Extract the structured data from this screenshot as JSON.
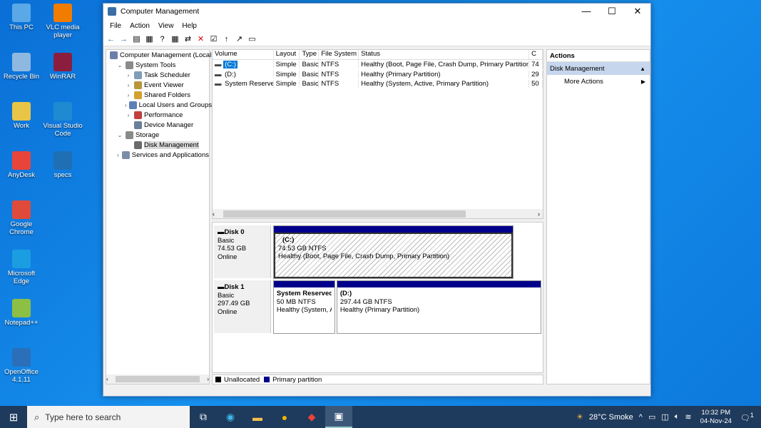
{
  "desktop": {
    "icons": [
      {
        "label": "This PC",
        "color": "#5aa9e6"
      },
      {
        "label": "VLC media player",
        "color": "#f07c00"
      },
      {
        "label": "Recycle Bin",
        "color": "#8fb8e0"
      },
      {
        "label": "WinRAR",
        "color": "#8b1e3f"
      },
      {
        "label": "Work",
        "color": "#e8c547"
      },
      {
        "label": "Visual Studio Code",
        "color": "#1f8ad2"
      },
      {
        "label": "AnyDesk",
        "color": "#e8443a"
      },
      {
        "label": "specs",
        "color": "#1f6fb5"
      },
      {
        "label": "Google Chrome",
        "color": "#e04a3a"
      },
      {
        "label": "Microsoft Edge",
        "color": "#1b9de2"
      },
      {
        "label": "Notepad++",
        "color": "#8dbf45"
      },
      {
        "label": "OpenOffice 4.1.11",
        "color": "#2a6fb8"
      }
    ]
  },
  "window": {
    "title": "Computer Management",
    "controls": {
      "minimize": "—",
      "maximize": "☐",
      "close": "✕"
    },
    "menu": [
      "File",
      "Action",
      "View",
      "Help"
    ],
    "toolbar": [
      "←",
      "→",
      "▤",
      "▦",
      "?",
      "▦",
      "⇄",
      "✕",
      "☑",
      "↑",
      "↗",
      "▭"
    ],
    "tree": [
      {
        "label": "Computer Management (Local",
        "exp": "",
        "indent": 0,
        "color": "#6b7fa8"
      },
      {
        "label": "System Tools",
        "exp": "⌄",
        "indent": 1,
        "color": "#8a8a8a"
      },
      {
        "label": "Task Scheduler",
        "exp": "›",
        "indent": 2,
        "color": "#7f9db9"
      },
      {
        "label": "Event Viewer",
        "exp": "›",
        "indent": 2,
        "color": "#b8963c"
      },
      {
        "label": "Shared Folders",
        "exp": "›",
        "indent": 2,
        "color": "#d4a030"
      },
      {
        "label": "Local Users and Groups",
        "exp": "›",
        "indent": 2,
        "color": "#5f7fb5"
      },
      {
        "label": "Performance",
        "exp": "›",
        "indent": 2,
        "color": "#c04040"
      },
      {
        "label": "Device Manager",
        "exp": "",
        "indent": 2,
        "color": "#6a7f9a"
      },
      {
        "label": "Storage",
        "exp": "⌄",
        "indent": 1,
        "color": "#8a8a8a"
      },
      {
        "label": "Disk Management",
        "exp": "",
        "indent": 2,
        "color": "#6b6b6b",
        "selected": true
      },
      {
        "label": "Services and Applications",
        "exp": "›",
        "indent": 1,
        "color": "#7a8ea8"
      }
    ],
    "volumes": {
      "headers": [
        "Volume",
        "Layout",
        "Type",
        "File System",
        "Status",
        "C"
      ],
      "rows": [
        [
          "(C:)",
          "Simple",
          "Basic",
          "NTFS",
          "Healthy (Boot, Page File, Crash Dump, Primary Partition)",
          "74"
        ],
        [
          "(D:)",
          "Simple",
          "Basic",
          "NTFS",
          "Healthy (Primary Partition)",
          "29"
        ],
        [
          "System Reserved",
          "Simple",
          "Basic",
          "NTFS",
          "Healthy (System, Active, Primary Partition)",
          "50"
        ]
      ]
    },
    "disks": [
      {
        "name": "Disk 0",
        "type": "Basic",
        "size": "74.53 GB",
        "state": "Online",
        "partitions": [
          {
            "name": "(C:)",
            "size": "74.53 GB NTFS",
            "status": "Healthy (Boot, Page File, Crash Dump, Primary Partition)",
            "selected": true
          }
        ]
      },
      {
        "name": "Disk 1",
        "type": "Basic",
        "size": "297.49 GB",
        "state": "Online",
        "partitions": [
          {
            "name": "System Reserved",
            "size": "50 MB NTFS",
            "status": "Healthy (System, A"
          },
          {
            "name": "(D:)",
            "size": "297.44 GB NTFS",
            "status": "Healthy (Primary Partition)"
          }
        ]
      }
    ],
    "legend": [
      {
        "label": "Unallocated",
        "color": "#000000"
      },
      {
        "label": "Primary partition",
        "color": "#00008b"
      }
    ],
    "actions": {
      "header": "Actions",
      "section": "Disk Management",
      "items": [
        "More Actions"
      ]
    }
  },
  "taskbar": {
    "search_placeholder": "Type here to search",
    "weather": "28°C  Smoke",
    "time": "10:32 PM",
    "date": "04-Nov-24",
    "notification_count": "1"
  }
}
